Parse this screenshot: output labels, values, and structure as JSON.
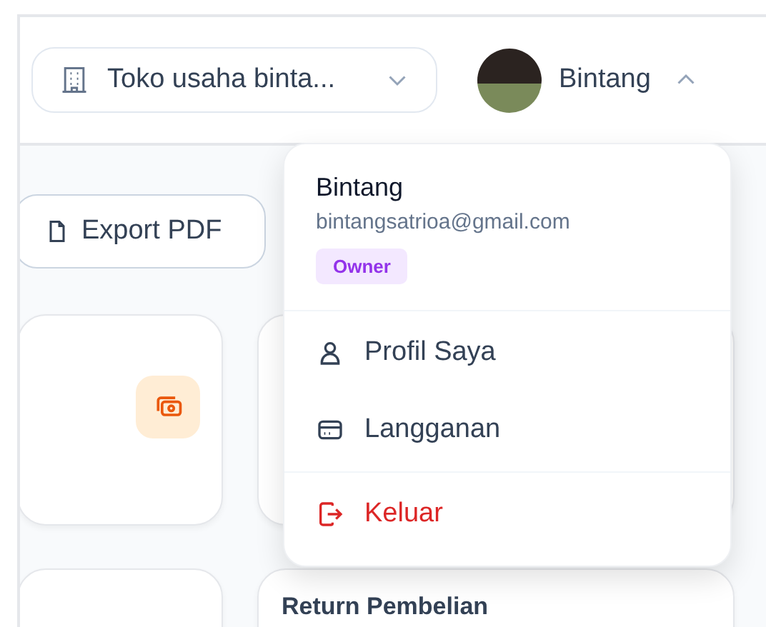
{
  "header": {
    "store_selector": {
      "label": "Toko usaha binta..."
    },
    "user": {
      "name": "Bintang",
      "menu_open": true
    }
  },
  "toolbar": {
    "export_button": "Export PDF"
  },
  "summary_card": {
    "title": "Return Pembelian"
  },
  "user_menu": {
    "name": "Bintang",
    "email": "bintangsatrioa@gmail.com",
    "role": "Owner",
    "items": [
      {
        "kind": "profile",
        "label": "Profil Saya"
      },
      {
        "kind": "subscription",
        "label": "Langganan"
      },
      {
        "kind": "logout",
        "label": "Keluar"
      }
    ]
  }
}
